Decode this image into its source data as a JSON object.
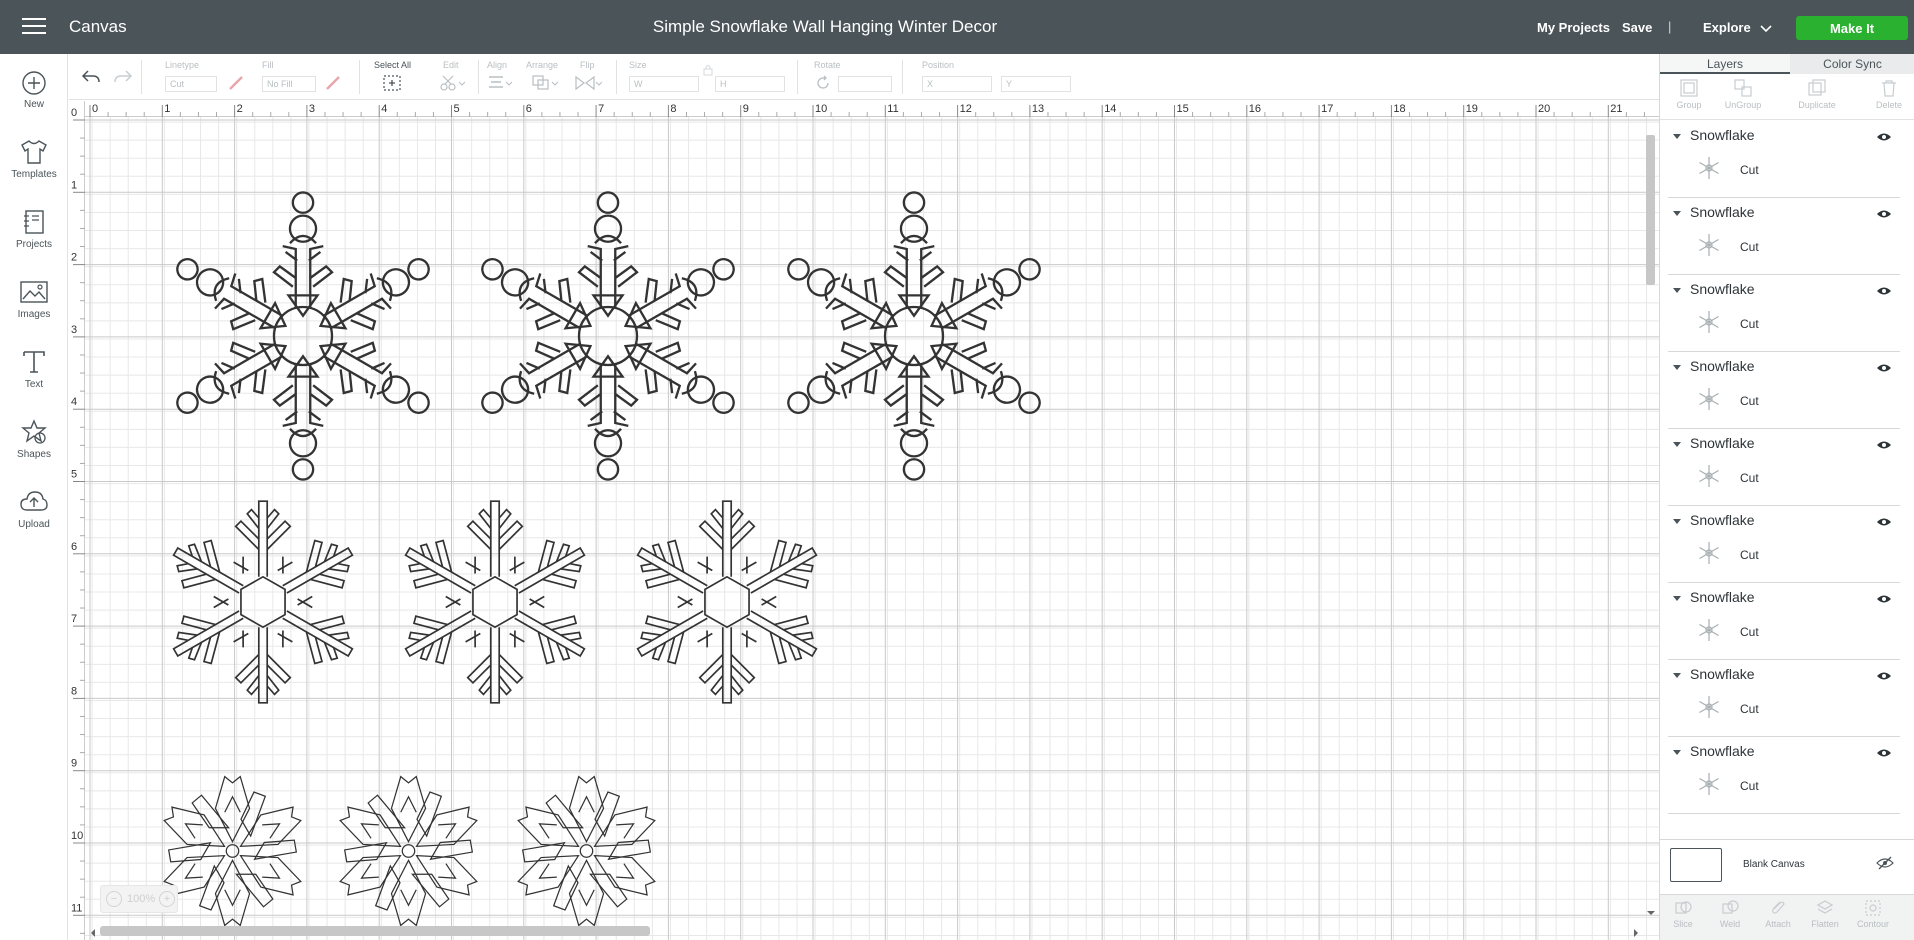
{
  "header": {
    "app_name": "Canvas",
    "title": "Simple Snowflake Wall Hanging Winter Decor",
    "my_projects": "My Projects",
    "save": "Save",
    "separator": "|",
    "explore": "Explore",
    "make_it": "Make It"
  },
  "leftbar": {
    "items": [
      {
        "label": "New",
        "icon": "plus-circle-icon"
      },
      {
        "label": "Templates",
        "icon": "tshirt-icon"
      },
      {
        "label": "Projects",
        "icon": "projects-icon"
      },
      {
        "label": "Images",
        "icon": "image-icon"
      },
      {
        "label": "Text",
        "icon": "text-icon"
      },
      {
        "label": "Shapes",
        "icon": "shapes-icon"
      },
      {
        "label": "Upload",
        "icon": "cloud-upload-icon"
      }
    ]
  },
  "toolbar": {
    "linetype_label": "Linetype",
    "linetype_value": "Cut",
    "fill_label": "Fill",
    "fill_value": "No Fill",
    "select_all": "Select All",
    "edit": "Edit",
    "align": "Align",
    "arrange": "Arrange",
    "flip": "Flip",
    "size": "Size",
    "w": "W",
    "h": "H",
    "rotate": "Rotate",
    "position": "Position",
    "x": "X",
    "y": "Y"
  },
  "ruler": {
    "top": [
      "0",
      "1",
      "2",
      "3",
      "4",
      "5",
      "6",
      "7",
      "8",
      "9",
      "10",
      "11",
      "12",
      "13",
      "14",
      "15",
      "16",
      "17",
      "18",
      "19",
      "20",
      "21"
    ],
    "left": [
      "0",
      "1",
      "2",
      "3",
      "4",
      "5",
      "6",
      "7",
      "8",
      "9",
      "10",
      "11"
    ]
  },
  "zoom": "100%",
  "panel": {
    "tab_layers": "Layers",
    "tab_color_sync": "Color Sync",
    "actions": [
      "Group",
      "UnGroup",
      "Duplicate",
      "Delete"
    ],
    "layers": [
      {
        "name": "Snowflake",
        "sub": "Cut"
      },
      {
        "name": "Snowflake",
        "sub": "Cut"
      },
      {
        "name": "Snowflake",
        "sub": "Cut"
      },
      {
        "name": "Snowflake",
        "sub": "Cut"
      },
      {
        "name": "Snowflake",
        "sub": "Cut"
      },
      {
        "name": "Snowflake",
        "sub": "Cut"
      },
      {
        "name": "Snowflake",
        "sub": "Cut"
      },
      {
        "name": "Snowflake",
        "sub": "Cut"
      },
      {
        "name": "Snowflake",
        "sub": "Cut"
      }
    ],
    "blank_canvas": "Blank Canvas",
    "bottom_actions": [
      "Slice",
      "Weld",
      "Attach",
      "Flatten",
      "Contour"
    ]
  },
  "colors": {
    "header_bg": "#4a5459",
    "make_it_green": "#29b12f"
  }
}
